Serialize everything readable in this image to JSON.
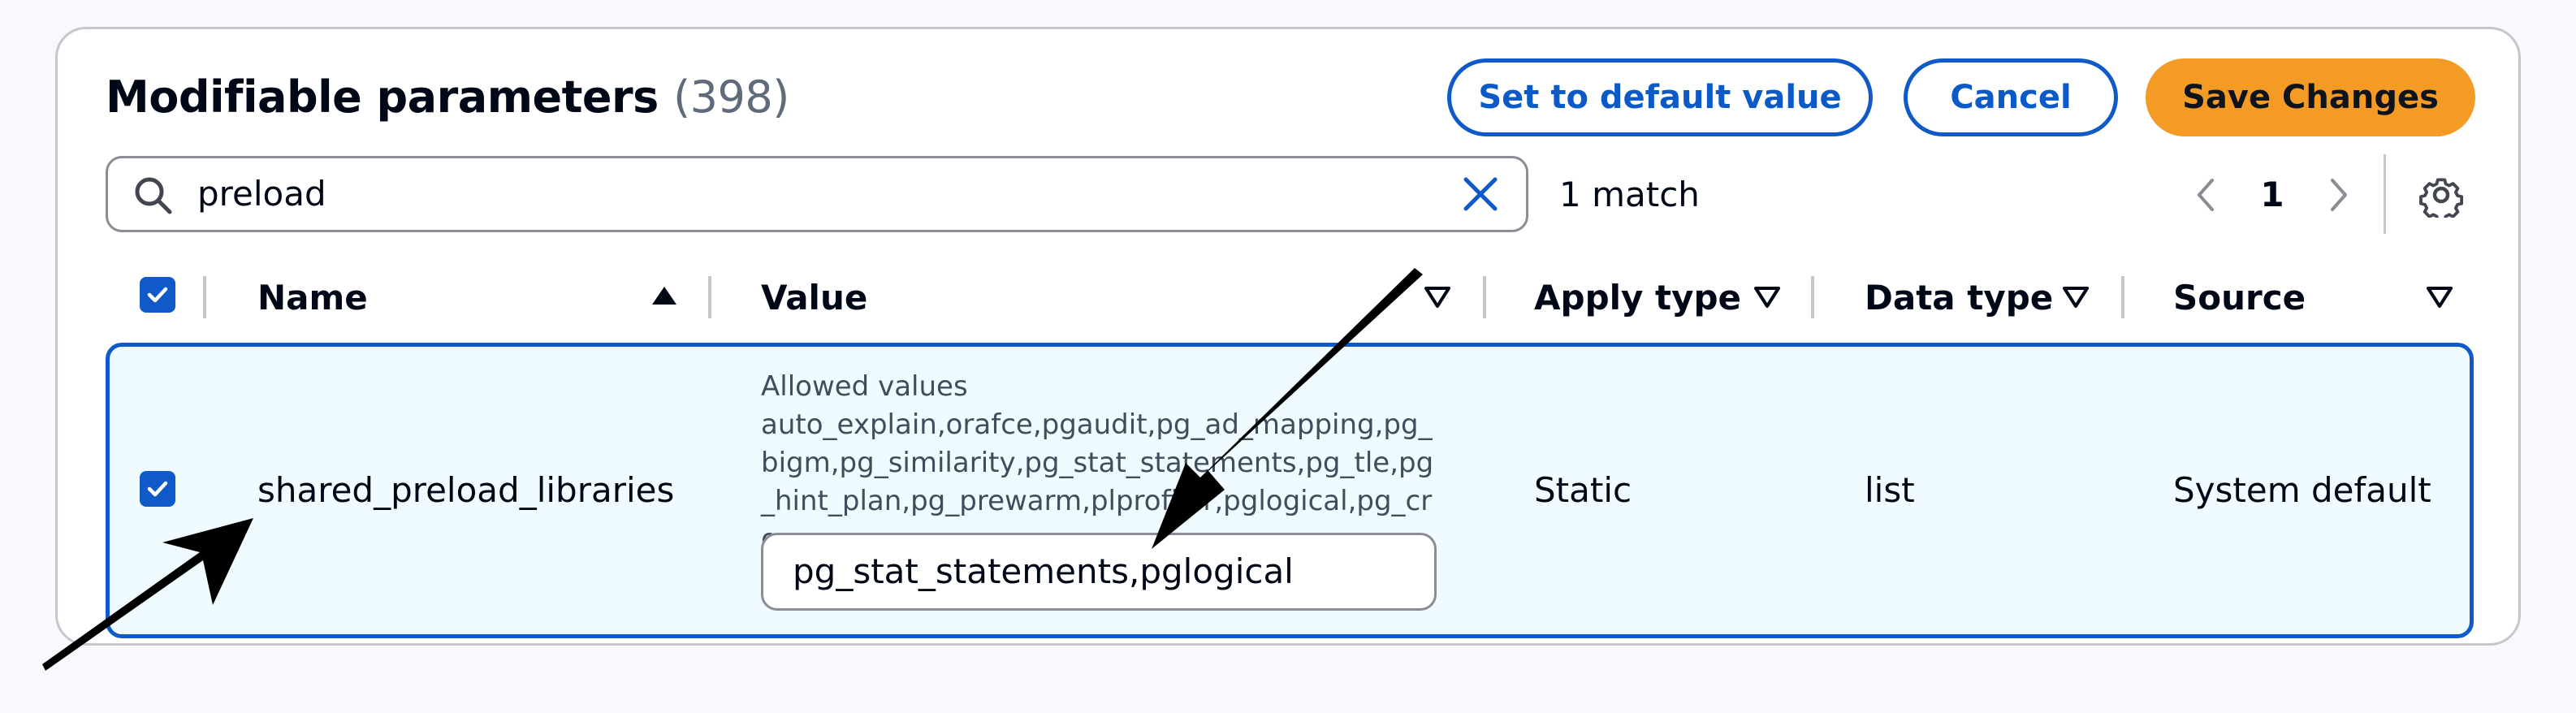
{
  "header": {
    "title": "Modifiable parameters",
    "count": "(398)",
    "buttons": {
      "set_default": "Set to default value",
      "cancel": "Cancel",
      "save": "Save Changes"
    }
  },
  "search": {
    "value": "preload",
    "icons": {
      "search": "search-icon",
      "clear": "close-icon"
    }
  },
  "results": {
    "matches": "1 match"
  },
  "pagination": {
    "current_page": "1",
    "icons": {
      "prev": "chevron-left-icon",
      "next": "chevron-right-icon",
      "settings": "gear-icon"
    }
  },
  "table": {
    "columns": {
      "name": "Name",
      "value": "Value",
      "apply_type": "Apply type",
      "data_type": "Data type",
      "source": "Source"
    },
    "rows": [
      {
        "selected": true,
        "name": "shared_preload_libraries",
        "allowed_label": "Allowed values",
        "allowed_values": "auto_explain,orafce,pgaudit,pg_ad_mapping,pg_bigm,pg_similarity,pg_stat_statements,pg_tle,pg_hint_plan,pg_prewarm,plprofiler,pglogical,pg_cron",
        "value": "pg_stat_statements,pglogical",
        "apply_type": "Static",
        "data_type": "list",
        "source": "System default"
      }
    ]
  },
  "colors": {
    "accent": "#0f5ac8",
    "primary_button": "#f49b26",
    "selected_row_bg": "#f0fbff",
    "annotation_arrow": "#000000"
  }
}
